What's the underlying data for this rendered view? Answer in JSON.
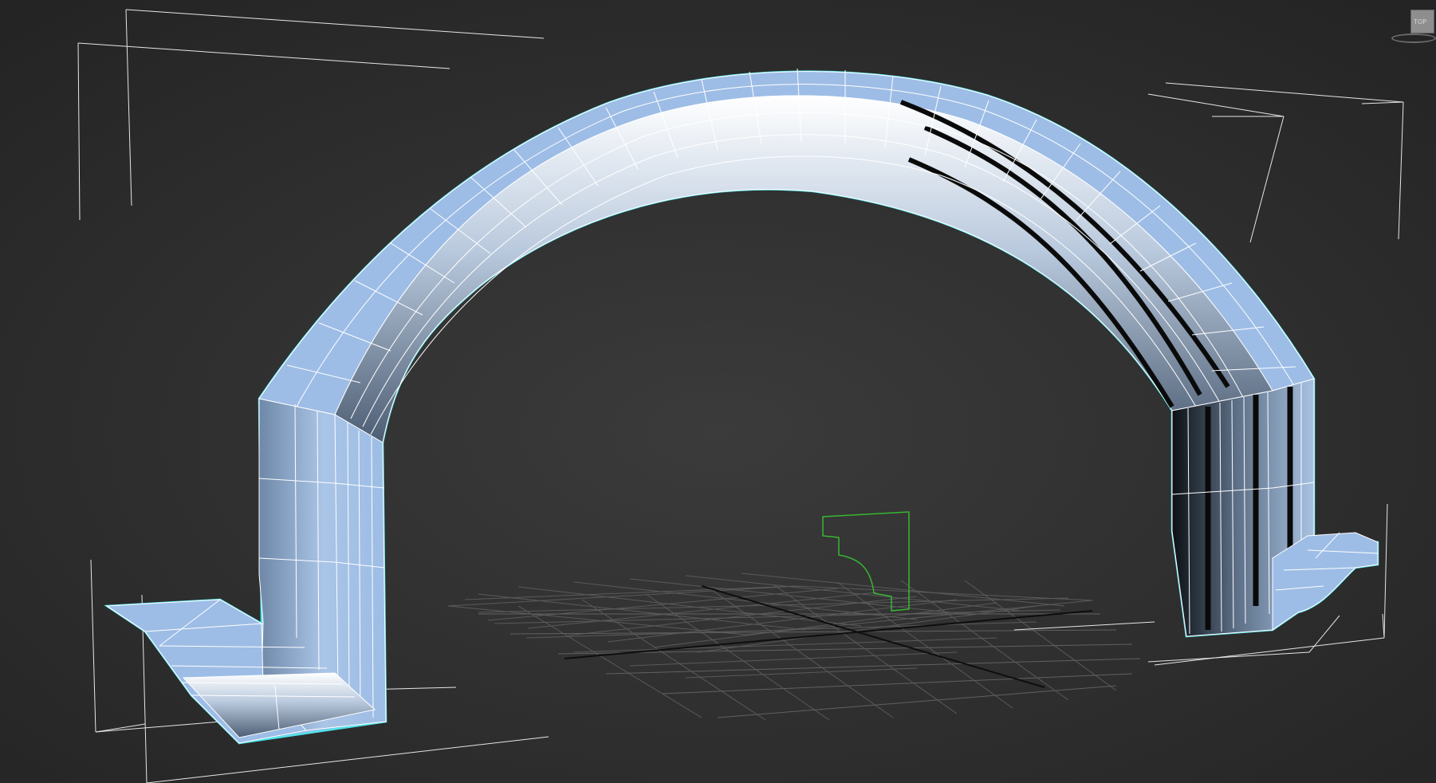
{
  "viewport": {
    "selected_object": "arch",
    "selection_color": "#4fe3ea",
    "mesh_color": "#9dbde6",
    "wire_color": "#ffffff",
    "spline_color": "#37b832",
    "grid_color": "#5a5a5a",
    "background_color": "#2b2b2b"
  },
  "viewcube": {
    "face_label": "TOP",
    "icon": "viewcube-icon"
  }
}
